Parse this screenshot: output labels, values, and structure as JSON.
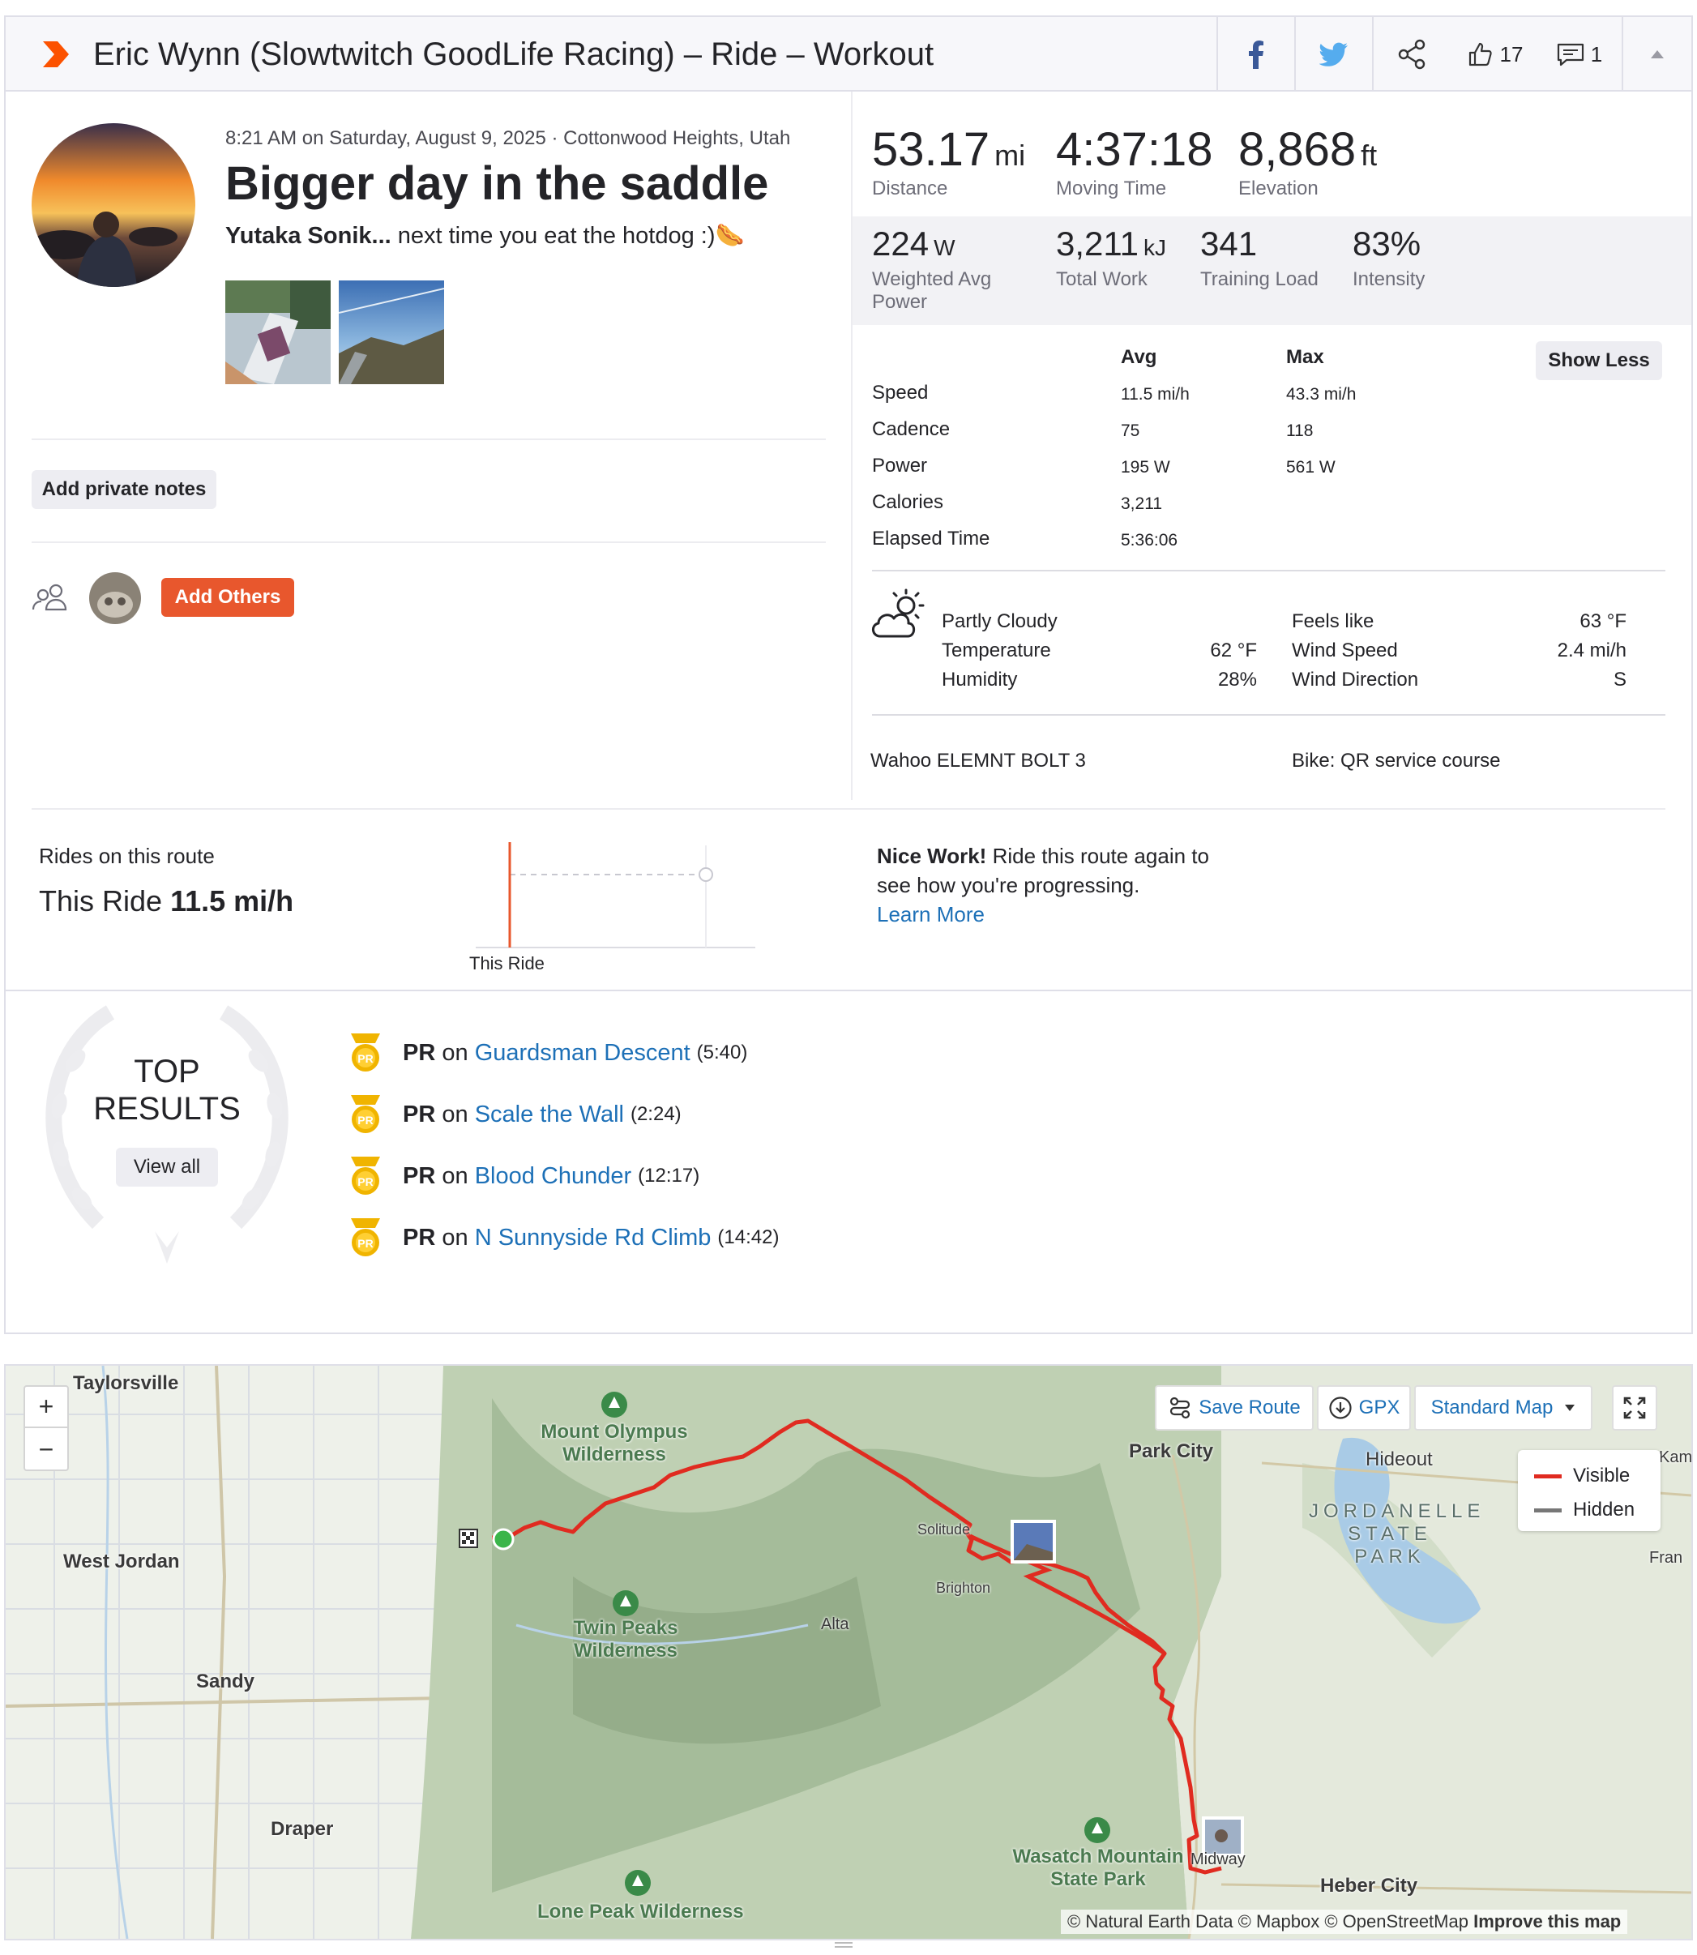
{
  "header": {
    "title": "Eric Wynn (Slowtwitch GoodLife Racing) – Ride – Workout",
    "kudos_count": "17",
    "comment_count": "1"
  },
  "activity": {
    "meta": "8:21 AM on Saturday, August 9, 2025 · Cottonwood Heights, Utah",
    "title": "Bigger day in the saddle",
    "desc_name": "Yutaka Sonik...",
    "desc_text": " next time you eat the hotdog :)🌭",
    "add_notes": "Add private notes",
    "add_others": "Add Others"
  },
  "primary_stats": [
    {
      "value": "53.17",
      "unit": "mi",
      "label": "Distance"
    },
    {
      "value": "4:37:18",
      "unit": "",
      "label": "Moving Time"
    },
    {
      "value": "8,868",
      "unit": "ft",
      "label": "Elevation"
    }
  ],
  "secondary_stats": [
    {
      "value": "224",
      "unit": "W",
      "label": "Weighted Avg",
      "label2": "Power"
    },
    {
      "value": "3,211",
      "unit": "kJ",
      "label": "Total Work",
      "label2": ""
    },
    {
      "value": "341",
      "unit": "",
      "label": "Training Load",
      "label2": ""
    },
    {
      "value": "83%",
      "unit": "",
      "label": "Intensity",
      "label2": ""
    }
  ],
  "details": {
    "col_avg": "Avg",
    "col_max": "Max",
    "show_less": "Show Less",
    "rows": [
      {
        "label": "Speed",
        "avg": "11.5 mi/h",
        "max": "43.3 mi/h"
      },
      {
        "label": "Cadence",
        "avg": "75",
        "max": "118"
      },
      {
        "label": "Power",
        "avg": "195 W",
        "max": "561 W"
      },
      {
        "label": "Calories",
        "avg": "3,211",
        "max": ""
      },
      {
        "label": "Elapsed Time",
        "avg": "5:36:06",
        "max": ""
      }
    ]
  },
  "weather": {
    "condition": "Partly Cloudy",
    "temperature_label": "Temperature",
    "temperature": "62 °F",
    "humidity_label": "Humidity",
    "humidity": "28%",
    "feels_label": "Feels like",
    "feels": "63 °F",
    "wind_speed_label": "Wind Speed",
    "wind_speed": "2.4 mi/h",
    "wind_dir_label": "Wind Direction",
    "wind_dir": "S"
  },
  "device": "Wahoo ELEMNT BOLT 3",
  "bike": "Bike: QR service course",
  "route": {
    "heading": "Rides on this route",
    "this_ride_label": "This Ride",
    "this_ride_value": "11.5 mi/h",
    "chart_label": "This Ride",
    "nice_bold": "Nice Work!",
    "nice_text1": " Ride this route again to",
    "nice_text2": "see how you're progressing.",
    "learn_more": "Learn More"
  },
  "top_results": {
    "title1": "TOP",
    "title2": "RESULTS",
    "view_all": "View all",
    "items": [
      {
        "pr": "PR",
        "on": "on",
        "segment": "Guardsman Descent",
        "time": "(5:40)"
      },
      {
        "pr": "PR",
        "on": "on",
        "segment": "Scale the Wall",
        "time": "(2:24)"
      },
      {
        "pr": "PR",
        "on": "on",
        "segment": "Blood Chunder",
        "time": "(12:17)"
      },
      {
        "pr": "PR",
        "on": "on",
        "segment": "N Sunnyside Rd Climb",
        "time": "(14:42)"
      }
    ]
  },
  "map": {
    "save_route": "Save Route",
    "gpx": "GPX",
    "map_type": "Standard Map",
    "zoom_in": "+",
    "zoom_out": "−",
    "legend_visible": "Visible",
    "legend_hidden": "Hidden",
    "attribution": "© Natural Earth Data © Mapbox © OpenStreetMap",
    "improve": "Improve this map",
    "places": {
      "taylorsville": "Taylorsville",
      "west_jordan": "West Jordan",
      "sandy": "Sandy",
      "draper": "Draper",
      "park_city": "Park City",
      "hideout": "Hideout",
      "solitude": "Solitude",
      "brighton": "Brighton",
      "alta": "Alta",
      "midway": "Midway",
      "heber": "Heber City",
      "fran": "Fran",
      "kam": "Kam",
      "mount_olympus_1": "Mount Olympus",
      "mount_olympus_2": "Wilderness",
      "twin_peaks_1": "Twin Peaks",
      "twin_peaks_2": "Wilderness",
      "wasatch_1": "Wasatch Mountain",
      "wasatch_2": "State Park",
      "lone_peak": "Lone Peak Wilderness",
      "jordanelle_1": "JORDANELLE",
      "jordanelle_2": "STATE",
      "jordanelle_3": "PARK"
    }
  },
  "colors": {
    "brand_orange": "#fc5200",
    "button_orange": "#e8572d",
    "link_blue": "#1d70b7",
    "route_red": "#e02b20",
    "pr_gold": "#f0b400"
  }
}
